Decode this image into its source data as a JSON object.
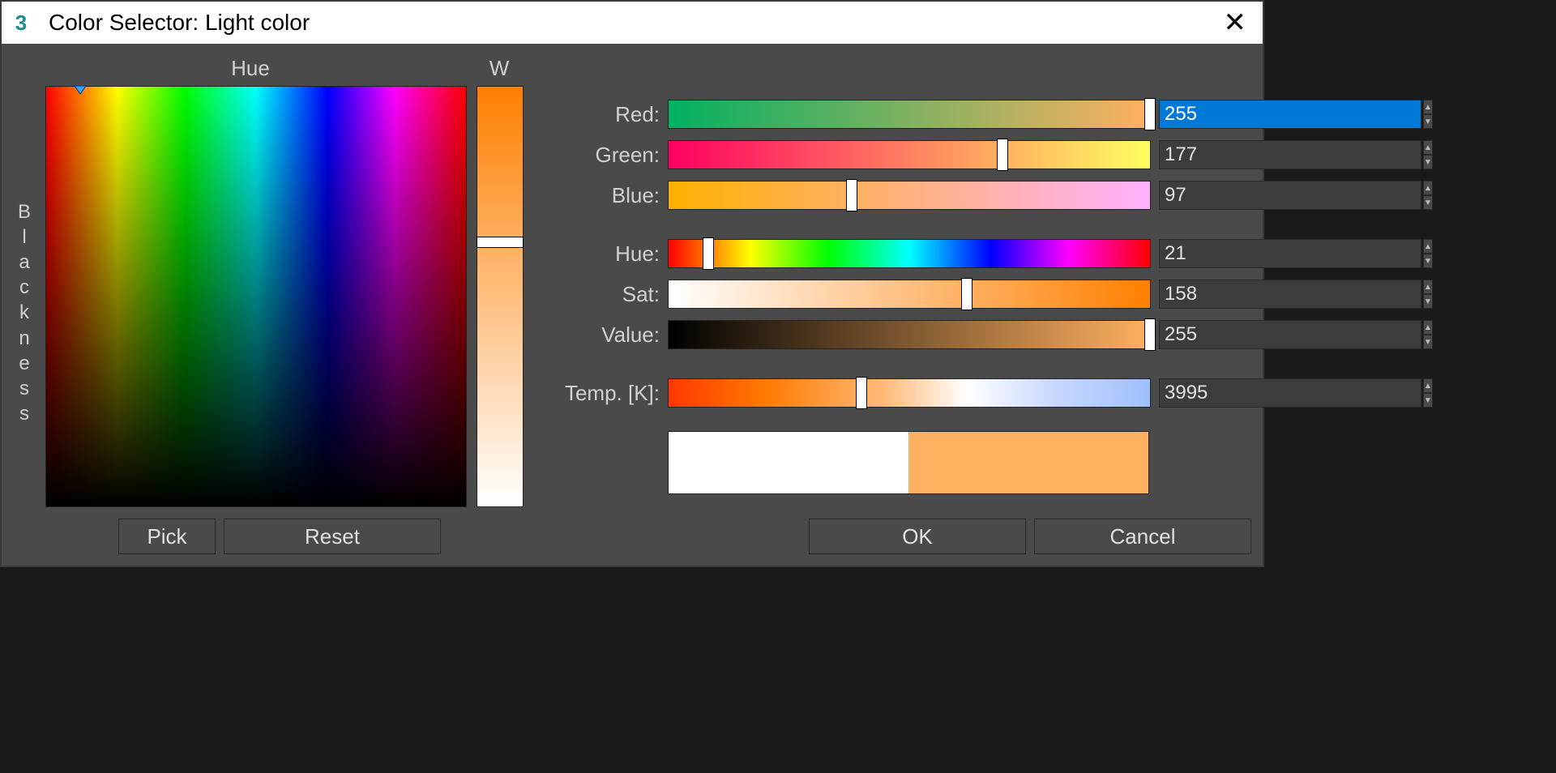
{
  "window": {
    "title": "Color Selector: Light color"
  },
  "labels": {
    "hue": "Hue",
    "whiteness": "W",
    "blackness": "Blackness",
    "red": "Red:",
    "green": "Green:",
    "blue": "Blue:",
    "hue_s": "Hue:",
    "sat": "Sat:",
    "value": "Value:",
    "temp": "Temp. [K]:"
  },
  "values": {
    "red": "255",
    "green": "177",
    "blue": "97",
    "hue": "21",
    "sat": "158",
    "value": "255",
    "temp": "3995"
  },
  "slider_percent": {
    "red": 100,
    "green": 69.4,
    "blue": 38.0,
    "hue": 8.2,
    "sat": 62.0,
    "value": 100,
    "temp": 40.0,
    "whiteness": 37.0,
    "field_x": 8.2,
    "field_y": 0.0
  },
  "gradients": {
    "red": {
      "from": "#00b161",
      "to": "#ffb161"
    },
    "green": {
      "from": "#ff0061",
      "to": "#ffff61"
    },
    "blue": {
      "from": "#ffb100",
      "to": "#ffb1ff"
    },
    "hue": "spectrum",
    "sat": {
      "from": "#ffffff",
      "to": "#ff7f00"
    },
    "value": {
      "from": "#000000",
      "to": "#ffb161"
    },
    "temp": "kelvin",
    "whiteness": {
      "from": "#ff7f00",
      "to": "#ffffff"
    }
  },
  "swatches": {
    "old": "#ffffff",
    "new": "#ffb161"
  },
  "buttons": {
    "pick": "Pick",
    "reset": "Reset",
    "ok": "OK",
    "cancel": "Cancel"
  }
}
